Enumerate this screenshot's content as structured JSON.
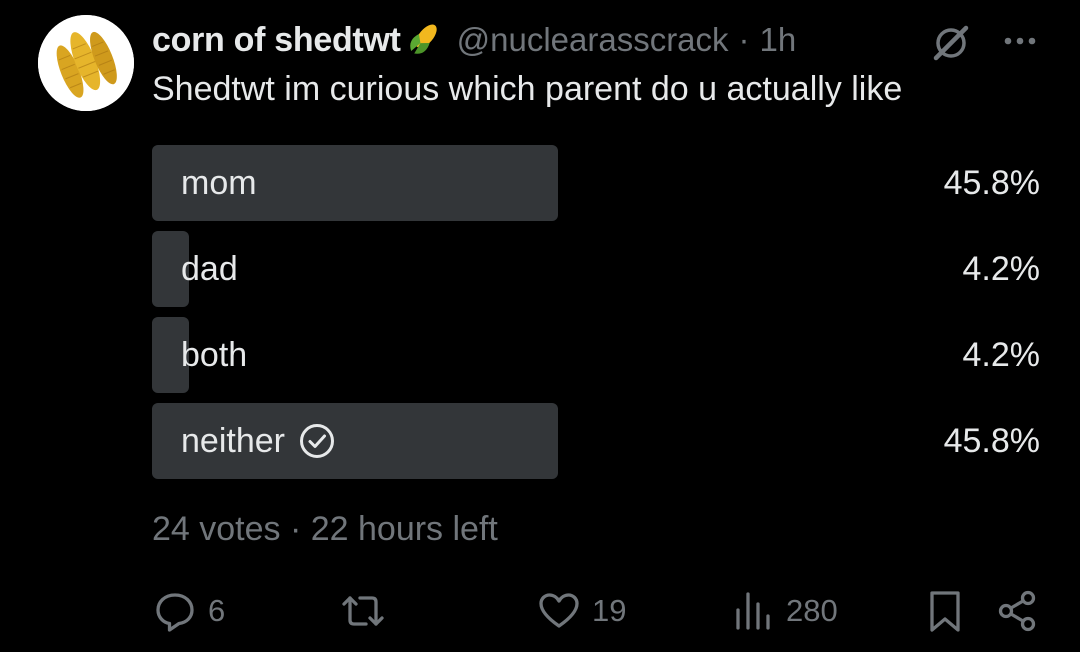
{
  "tweet": {
    "display_name": "corn of shedtwt",
    "handle": "@nuclearasscrack",
    "separator": "·",
    "time": "1h",
    "text": "Shedtwt im curious which parent do u actually like"
  },
  "poll": {
    "options": [
      {
        "label": "mom",
        "percent": "45.8%",
        "fraction": 0.458,
        "selected": false
      },
      {
        "label": "dad",
        "percent": "4.2%",
        "fraction": 0.042,
        "selected": false
      },
      {
        "label": "both",
        "percent": "4.2%",
        "fraction": 0.042,
        "selected": false
      },
      {
        "label": "neither",
        "percent": "45.8%",
        "fraction": 0.458,
        "selected": true
      }
    ],
    "meta": "24 votes · 22 hours left"
  },
  "actions": {
    "replies": "6",
    "retweets": "",
    "likes": "19",
    "views": "280"
  },
  "icons": [
    "corn-avatar",
    "corn-emoji-icon",
    "grok-icon",
    "more-icon",
    "check-circle-icon",
    "reply-icon",
    "retweet-icon",
    "like-icon",
    "views-icon",
    "bookmark-icon",
    "share-icon"
  ],
  "colors": {
    "background": "#000000",
    "text": "#e7e9ea",
    "muted": "#71767b",
    "poll_bar": "#333639"
  }
}
